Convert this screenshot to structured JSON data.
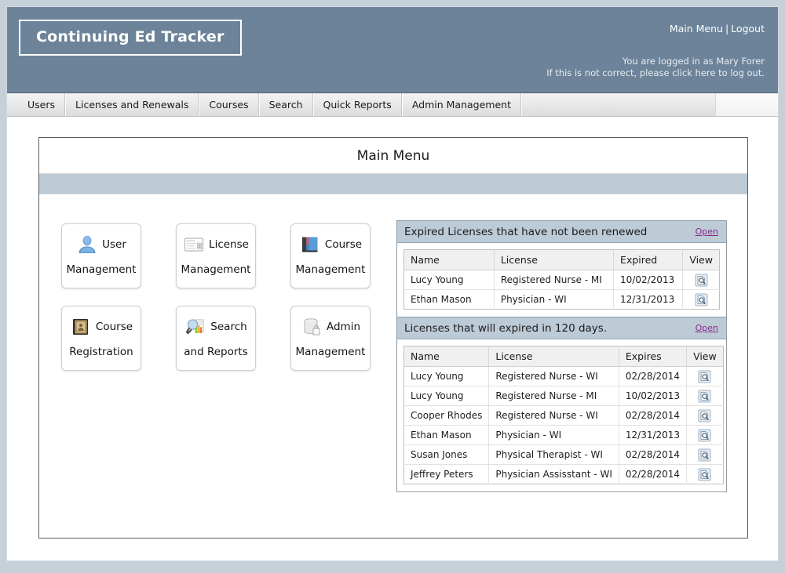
{
  "header": {
    "logo_text": "Continuing Ed Tracker",
    "main_menu_link": "Main Menu",
    "separator": "|",
    "logout_link": "Logout",
    "logged_in_line": "You are logged in as Mary Forer",
    "not_correct_line": "If this is not correct, please click here to log out."
  },
  "nav": {
    "items": [
      {
        "label": "Users"
      },
      {
        "label": "Licenses and Renewals"
      },
      {
        "label": "Courses"
      },
      {
        "label": "Search"
      },
      {
        "label": "Quick Reports"
      },
      {
        "label": "Admin Management"
      }
    ]
  },
  "main": {
    "title": "Main Menu",
    "tiles": [
      {
        "icon": "user-icon",
        "word1": "User",
        "word2": "Management"
      },
      {
        "icon": "license-icon",
        "word1": "License",
        "word2": "Management"
      },
      {
        "icon": "book-icon",
        "word1": "Course",
        "word2": "Management"
      },
      {
        "icon": "registry-icon",
        "word1": "Course",
        "word2": "Registration"
      },
      {
        "icon": "search-report-icon",
        "word1": "Search",
        "word2": "and Reports"
      },
      {
        "icon": "database-icon",
        "word1": "Admin",
        "word2": "Management"
      }
    ]
  },
  "panels": [
    {
      "title": "Expired Licenses that have not been renewed",
      "open_label": "Open",
      "columns": [
        "Name",
        "License",
        "Expired",
        "View"
      ],
      "rows": [
        {
          "name": "Lucy Young",
          "license": "Registered Nurse - MI",
          "date": "10/02/2013",
          "view": "view-icon"
        },
        {
          "name": "Ethan Mason",
          "license": "Physician - WI",
          "date": "12/31/2013",
          "view": "view-icon"
        }
      ]
    },
    {
      "title": "Licenses that will expired in 120 days.",
      "open_label": "Open",
      "columns": [
        "Name",
        "License",
        "Expires",
        "View"
      ],
      "rows": [
        {
          "name": "Lucy Young",
          "license": "Registered Nurse - WI",
          "date": "02/28/2014",
          "view": "view-icon"
        },
        {
          "name": "Lucy Young",
          "license": "Registered Nurse - MI",
          "date": "10/02/2013",
          "view": "view-icon"
        },
        {
          "name": "Cooper Rhodes",
          "license": "Registered Nurse - WI",
          "date": "02/28/2014",
          "view": "view-icon"
        },
        {
          "name": "Ethan Mason",
          "license": "Physician - WI",
          "date": "12/31/2013",
          "view": "view-icon"
        },
        {
          "name": "Susan Jones",
          "license": "Physical Therapist - WI",
          "date": "02/28/2014",
          "view": "view-icon"
        },
        {
          "name": "Jeffrey Peters",
          "license": "Physician Assisstant - WI",
          "date": "02/28/2014",
          "view": "view-icon"
        }
      ]
    }
  ],
  "colors": {
    "banner": "#6c8399",
    "band": "#bdcbd6",
    "page_bg": "#c5d0d8",
    "link": "#8a2a8a"
  }
}
